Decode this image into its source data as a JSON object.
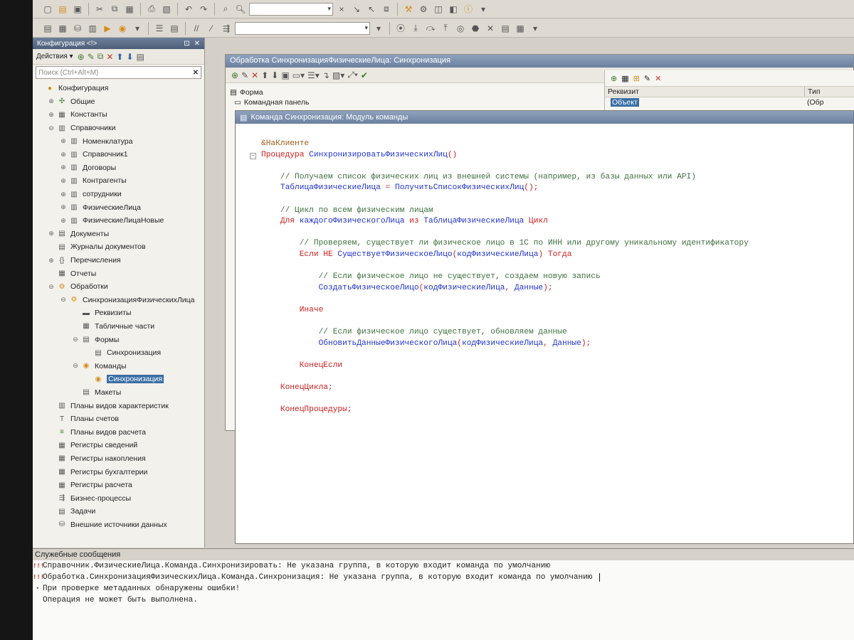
{
  "config_panel": {
    "title": "Конфигурация <!>",
    "actions_label": "Действия ▾",
    "search_placeholder": "Поиск (Ctrl+Alt+M)",
    "tree": [
      {
        "label": "Конфигурация",
        "level": 0,
        "expander": "",
        "icon": "config-icon"
      },
      {
        "label": "Общие",
        "level": 1,
        "expander": "⊕",
        "icon": "common-icon"
      },
      {
        "label": "Константы",
        "level": 1,
        "expander": "⊕",
        "icon": "constants-icon"
      },
      {
        "label": "Справочники",
        "level": 1,
        "expander": "⊖",
        "icon": "catalogs-icon"
      },
      {
        "label": "Номенклатура",
        "level": 2,
        "expander": "⊕",
        "icon": "catalog-icon"
      },
      {
        "label": "Справочник1",
        "level": 2,
        "expander": "⊕",
        "icon": "catalog-icon"
      },
      {
        "label": "Договоры",
        "level": 2,
        "expander": "⊕",
        "icon": "catalog-icon"
      },
      {
        "label": "Контрагенты",
        "level": 2,
        "expander": "⊕",
        "icon": "catalog-icon"
      },
      {
        "label": "сотрудники",
        "level": 2,
        "expander": "⊕",
        "icon": "catalog-icon"
      },
      {
        "label": "ФизическиеЛица",
        "level": 2,
        "expander": "⊕",
        "icon": "catalog-icon"
      },
      {
        "label": "ФизическиеЛицаНовые",
        "level": 2,
        "expander": "⊕",
        "icon": "catalog-icon"
      },
      {
        "label": "Документы",
        "level": 1,
        "expander": "⊕",
        "icon": "documents-icon"
      },
      {
        "label": "Журналы документов",
        "level": 1,
        "expander": "",
        "icon": "journals-icon"
      },
      {
        "label": "Перечисления",
        "level": 1,
        "expander": "⊕",
        "icon": "enums-icon"
      },
      {
        "label": "Отчеты",
        "level": 1,
        "expander": "",
        "icon": "reports-icon"
      },
      {
        "label": "Обработки",
        "level": 1,
        "expander": "⊖",
        "icon": "processings-icon"
      },
      {
        "label": "СинхронизацияФизическихЛица",
        "level": 2,
        "expander": "⊖",
        "icon": "processing-icon"
      },
      {
        "label": "Реквизиты",
        "level": 3,
        "expander": "",
        "icon": "attributes-icon"
      },
      {
        "label": "Табличные части",
        "level": 3,
        "expander": "",
        "icon": "tabular-icon"
      },
      {
        "label": "Формы",
        "level": 3,
        "expander": "⊖",
        "icon": "forms-icon"
      },
      {
        "label": "Синхронизация",
        "level": 4,
        "expander": "",
        "icon": "form-icon"
      },
      {
        "label": "Команды",
        "level": 3,
        "expander": "⊖",
        "icon": "commands-icon"
      },
      {
        "label": "Синхронизация",
        "level": 4,
        "expander": "",
        "icon": "command-icon",
        "selected": true
      },
      {
        "label": "Макеты",
        "level": 3,
        "expander": "",
        "icon": "templates-icon"
      },
      {
        "label": "Планы видов характеристик",
        "level": 1,
        "expander": "",
        "icon": "chart-types-icon"
      },
      {
        "label": "Планы счетов",
        "level": 1,
        "expander": "",
        "icon": "accounts-icon"
      },
      {
        "label": "Планы видов расчета",
        "level": 1,
        "expander": "",
        "icon": "calc-types-icon"
      },
      {
        "label": "Регистры сведений",
        "level": 1,
        "expander": "",
        "icon": "info-registers-icon"
      },
      {
        "label": "Регистры накопления",
        "level": 1,
        "expander": "",
        "icon": "accum-registers-icon"
      },
      {
        "label": "Регистры бухгалтерии",
        "level": 1,
        "expander": "",
        "icon": "accounting-registers-icon"
      },
      {
        "label": "Регистры расчета",
        "level": 1,
        "expander": "",
        "icon": "calc-registers-icon"
      },
      {
        "label": "Бизнес-процессы",
        "level": 1,
        "expander": "",
        "icon": "business-processes-icon"
      },
      {
        "label": "Задачи",
        "level": 1,
        "expander": "",
        "icon": "tasks-icon"
      },
      {
        "label": "Внешние источники данных",
        "level": 1,
        "expander": "",
        "icon": "external-sources-icon"
      }
    ]
  },
  "processing_window": {
    "title": "Обработка СинхронизацияФизическиеЛица: Синхронизация",
    "form_tree": [
      "Форма",
      "Командная панель"
    ],
    "requisite_col": "Реквизит",
    "type_col": "Тип",
    "requisite_value": "Объект",
    "type_value": "(Обр"
  },
  "module_window": {
    "title": "Команда Синхронизация: Модуль команды",
    "code": [
      {
        "tokens": [
          {
            "t": "&НаКлиенте",
            "c": "pp"
          }
        ]
      },
      {
        "fold": "⊟",
        "tokens": [
          {
            "t": "Процедура ",
            "c": "kw"
          },
          {
            "t": "СинхронизироватьФизическихЛиц",
            "c": "id"
          },
          {
            "t": "()",
            "c": "pun"
          }
        ]
      },
      {
        "tokens": []
      },
      {
        "tokens": [
          {
            "t": "    // Получаем список физических лиц из внешней системы (например, из базы данных или API)",
            "c": "cm"
          }
        ]
      },
      {
        "tokens": [
          {
            "t": "    ТаблицаФизическиеЛица",
            "c": "id"
          },
          {
            "t": " = ",
            "c": "pun"
          },
          {
            "t": "ПолучитьСписокФизическихЛиц",
            "c": "id"
          },
          {
            "t": "();",
            "c": "pun"
          }
        ]
      },
      {
        "tokens": []
      },
      {
        "tokens": [
          {
            "t": "    // Цикл по всем физическим лицам",
            "c": "cm"
          }
        ]
      },
      {
        "tokens": [
          {
            "t": "    Для ",
            "c": "kw"
          },
          {
            "t": "каждогоФизическогоЛица",
            "c": "id"
          },
          {
            "t": " из ",
            "c": "kw"
          },
          {
            "t": "ТаблицаФизическиеЛица",
            "c": "id"
          },
          {
            "t": " Цикл",
            "c": "kw"
          }
        ]
      },
      {
        "tokens": []
      },
      {
        "tokens": [
          {
            "t": "        // Проверяем, существует ли физическое лицо в 1С по ИНН или другому уникальному идентификатору",
            "c": "cm"
          }
        ]
      },
      {
        "tokens": [
          {
            "t": "        Если НЕ ",
            "c": "kw"
          },
          {
            "t": "СуществуетФизическоеЛицо",
            "c": "id"
          },
          {
            "t": "(",
            "c": "pun"
          },
          {
            "t": "кодФизическиеЛица",
            "c": "id"
          },
          {
            "t": ") ",
            "c": "pun"
          },
          {
            "t": "Тогда",
            "c": "kw"
          }
        ]
      },
      {
        "tokens": []
      },
      {
        "tokens": [
          {
            "t": "            // Если физическое лицо не существует, создаем новую запись",
            "c": "cm"
          }
        ]
      },
      {
        "tokens": [
          {
            "t": "            СоздатьФизическоеЛицо",
            "c": "id"
          },
          {
            "t": "(",
            "c": "pun"
          },
          {
            "t": "кодФизическиеЛица",
            "c": "id"
          },
          {
            "t": ", ",
            "c": "pun"
          },
          {
            "t": "Данные",
            "c": "id"
          },
          {
            "t": ");",
            "c": "pun"
          }
        ]
      },
      {
        "tokens": []
      },
      {
        "tokens": [
          {
            "t": "        Иначе",
            "c": "kw"
          }
        ]
      },
      {
        "tokens": []
      },
      {
        "tokens": [
          {
            "t": "            // Если физическое лицо существует, обновляем данные",
            "c": "cm"
          }
        ]
      },
      {
        "tokens": [
          {
            "t": "            ОбновитьДанныеФизическогоЛица",
            "c": "id"
          },
          {
            "t": "(",
            "c": "pun"
          },
          {
            "t": "кодФизическиеЛица",
            "c": "id"
          },
          {
            "t": ", ",
            "c": "pun"
          },
          {
            "t": "Данные",
            "c": "id"
          },
          {
            "t": ");",
            "c": "pun"
          }
        ]
      },
      {
        "tokens": []
      },
      {
        "tokens": [
          {
            "t": "        КонецЕсли",
            "c": "kw"
          }
        ]
      },
      {
        "tokens": []
      },
      {
        "tokens": [
          {
            "t": "    КонецЦикла;",
            "c": "kw"
          }
        ]
      },
      {
        "tokens": []
      },
      {
        "tokens": [
          {
            "t": "    КонецПроцедуры;",
            "c": "kw"
          }
        ]
      }
    ]
  },
  "messages": {
    "title": "Служебные сообщения",
    "items": [
      {
        "icon": "!!!",
        "kind": "error",
        "text": "Справочник.ФизическиеЛица.Команда.Синхронизировать: Не указана группа, в которую входит команда по умолчанию"
      },
      {
        "icon": "!!!",
        "kind": "error",
        "text": "Обработка.СинхронизацияФизическихЛица.Команда.Синхронизация: Не указана группа, в которую входит команда по умолчанию",
        "cursor": true
      },
      {
        "icon": "•",
        "kind": "info",
        "text": "При проверке метаданных обнаружены ошибки!"
      },
      {
        "icon": "",
        "kind": "info",
        "text": "Операция не может быть выполнена."
      }
    ]
  }
}
